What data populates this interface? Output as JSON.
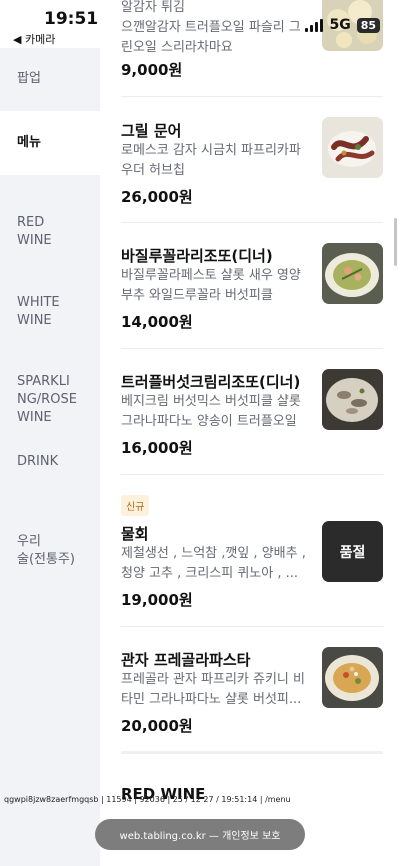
{
  "status": {
    "time": "19:51",
    "back_label": "◀ 카메라",
    "network": "5G",
    "battery": "85"
  },
  "sidebar": {
    "items": [
      {
        "label": "팝업"
      },
      {
        "label": "메뉴"
      },
      {
        "label": "RED\nWINE"
      },
      {
        "label": "WHITE\nWINE"
      },
      {
        "label": "SPARKLI\nNG/ROSE\nWINE"
      },
      {
        "label": "DRINK"
      },
      {
        "label": "우리\n술(전통주)"
      }
    ]
  },
  "menu": {
    "items": [
      {
        "name": "",
        "desc": "알감자 튀김\n으깬알감자 트러플오일 파슬리 그\n린오일 스리라차마요",
        "price": "9,000원"
      },
      {
        "name": "그릴 문어",
        "desc": "로메스코 감자 시금치 파프리카파\n우더 허브칩",
        "price": "26,000원"
      },
      {
        "name": "바질루꼴라리조또(디너)",
        "desc": "바질루꼴라페스토 샬롯 새우 영양\n부추 와일드루꼴라 버섯피클",
        "price": "14,000원"
      },
      {
        "name": "트러플버섯크림리조또(디너)",
        "desc": "베지크림 버섯믹스 버섯피클 샬롯\n그라나파다노 양송이 트러플오일",
        "price": "16,000원"
      },
      {
        "name": "물회",
        "badge": "신규",
        "desc": "제철생선 , 느억참 ,깻잎 , 양배추 ,\n청양 고추 , 크리스피 퀴노아 , ...",
        "price": "19,000원",
        "soldout": "품절"
      },
      {
        "name": "관자 프레골라파스타",
        "desc": "프레골라 관자 파프리카 쥬키니 비\n타민 그라나파다노 샬롯 버섯피...",
        "price": "20,000원"
      }
    ],
    "next_section": "RED WINE"
  },
  "debug": "qgwpi8jzw8zaerfmgqsb | 11594 | 92036 | 25 / 12 27 / 19:51:14 | /menu",
  "toast": "web.tabling.co.kr — 개인정보 보호"
}
